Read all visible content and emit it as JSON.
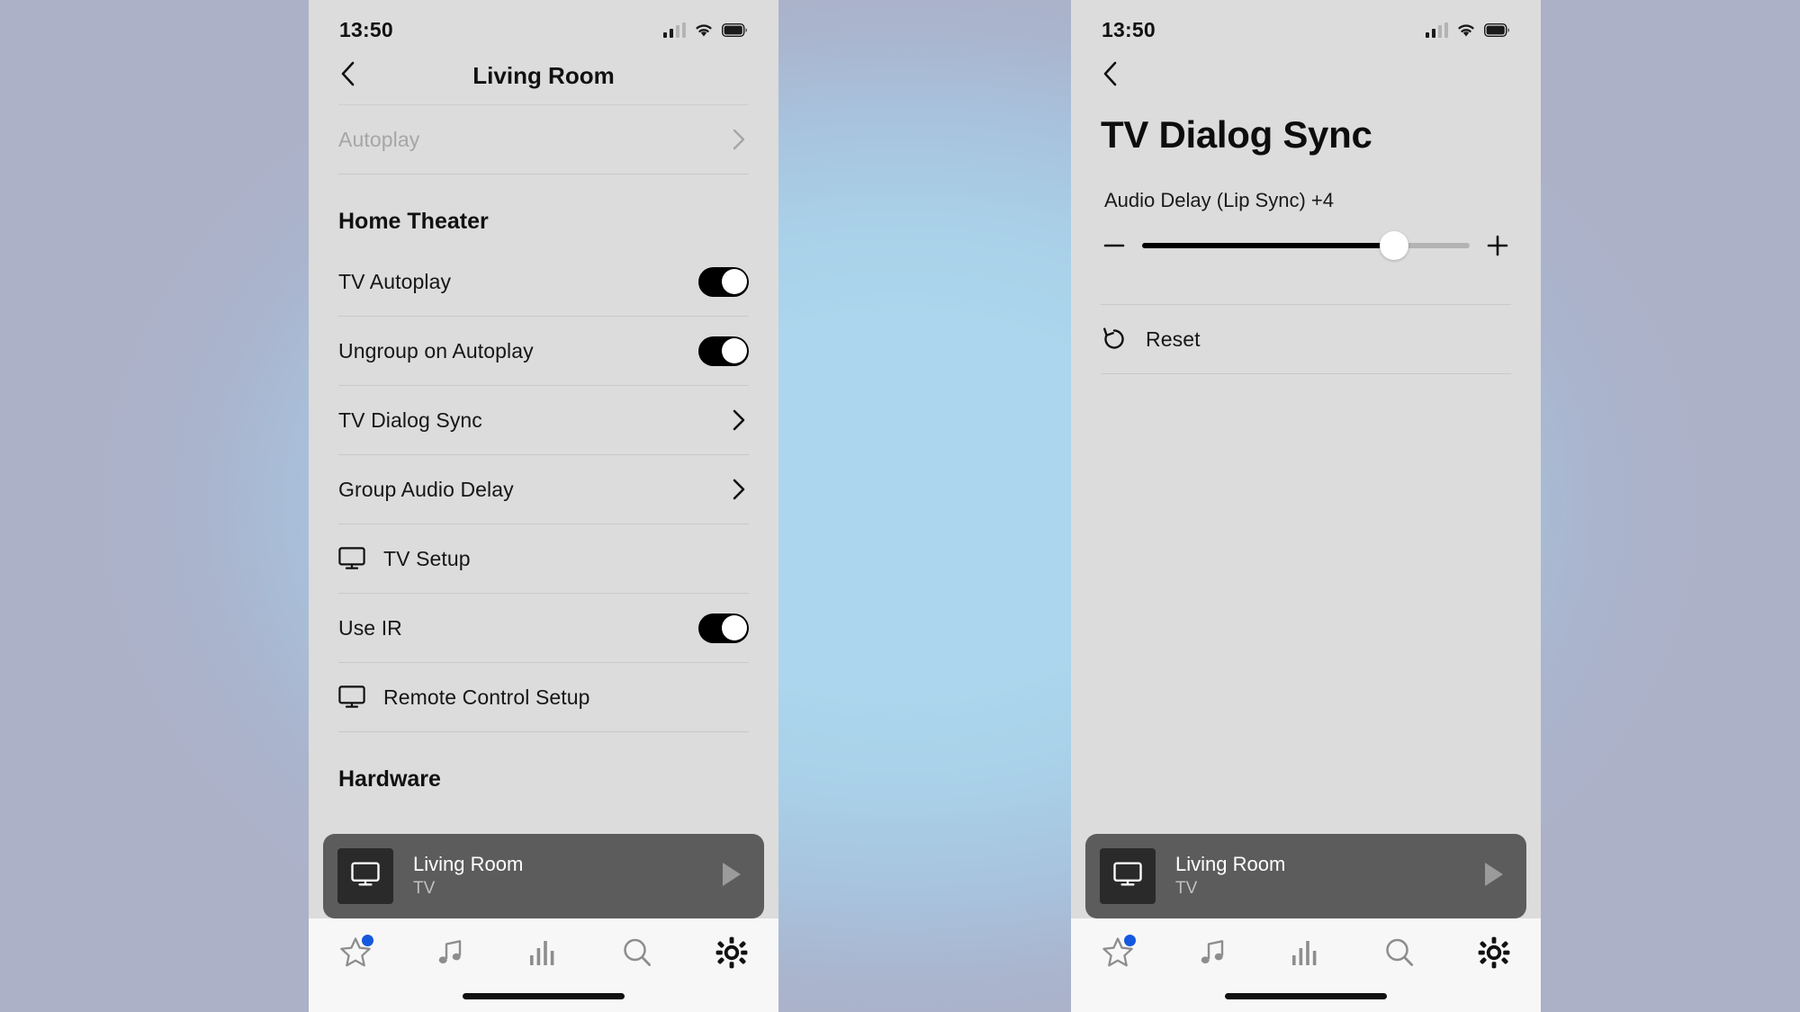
{
  "background": {
    "center_color": "#abd6ed",
    "edge_color": "#aab2ca"
  },
  "left_phone": {
    "status": {
      "time": "13:50",
      "cellular": "signal-bars-icon",
      "wifi": "wifi-icon",
      "battery": "battery-icon"
    },
    "nav": {
      "back": "chevron-left-icon",
      "title": "Living Room"
    },
    "rows_top": [
      {
        "label": "Autoplay",
        "type": "chevron",
        "disabled": true
      }
    ],
    "section": {
      "title": "Home Theater"
    },
    "rows_theater": [
      {
        "label": "TV Autoplay",
        "type": "toggle",
        "value": "on"
      },
      {
        "label": "Ungroup on Autoplay",
        "type": "toggle",
        "value": "on"
      },
      {
        "label": "TV Dialog Sync",
        "type": "chevron"
      },
      {
        "label": "Group Audio Delay",
        "type": "chevron"
      },
      {
        "label": "TV Setup",
        "type": "icon",
        "icon": "tv-icon"
      },
      {
        "label": "Use IR",
        "type": "toggle",
        "value": "on"
      },
      {
        "label": "Remote Control Setup",
        "type": "icon",
        "icon": "tv-icon"
      }
    ],
    "section2": {
      "title": "Hardware"
    },
    "now_playing": {
      "title": "Living Room",
      "subtitle": "TV",
      "art_icon": "tv-icon",
      "play_icon": "play-icon"
    },
    "tabs": [
      {
        "name": "favorites",
        "icon": "star-icon",
        "badge": true,
        "selected": false
      },
      {
        "name": "music",
        "icon": "music-note-icon",
        "badge": false,
        "selected": false
      },
      {
        "name": "levels",
        "icon": "equalizer-icon",
        "badge": false,
        "selected": false
      },
      {
        "name": "search",
        "icon": "search-icon",
        "badge": false,
        "selected": false
      },
      {
        "name": "settings",
        "icon": "gear-icon",
        "badge": false,
        "selected": true
      }
    ]
  },
  "right_phone": {
    "status": {
      "time": "13:50",
      "cellular": "signal-bars-icon",
      "wifi": "wifi-icon",
      "battery": "battery-icon"
    },
    "nav": {
      "back": "chevron-left-icon"
    },
    "title": "TV Dialog Sync",
    "slider": {
      "caption": "Audio Delay (Lip Sync) +4",
      "value": 4,
      "percent": 77,
      "minus_label": "−",
      "plus_label": "+"
    },
    "reset": {
      "label": "Reset",
      "icon": "rotate-left-icon"
    },
    "now_playing": {
      "title": "Living Room",
      "subtitle": "TV",
      "art_icon": "tv-icon",
      "play_icon": "play-icon"
    },
    "tabs": [
      {
        "name": "favorites",
        "icon": "star-icon",
        "badge": true,
        "selected": false
      },
      {
        "name": "music",
        "icon": "music-note-icon",
        "badge": false,
        "selected": false
      },
      {
        "name": "levels",
        "icon": "equalizer-icon",
        "badge": false,
        "selected": false
      },
      {
        "name": "search",
        "icon": "search-icon",
        "badge": false,
        "selected": false
      },
      {
        "name": "settings",
        "icon": "gear-icon",
        "badge": false,
        "selected": true
      }
    ]
  }
}
